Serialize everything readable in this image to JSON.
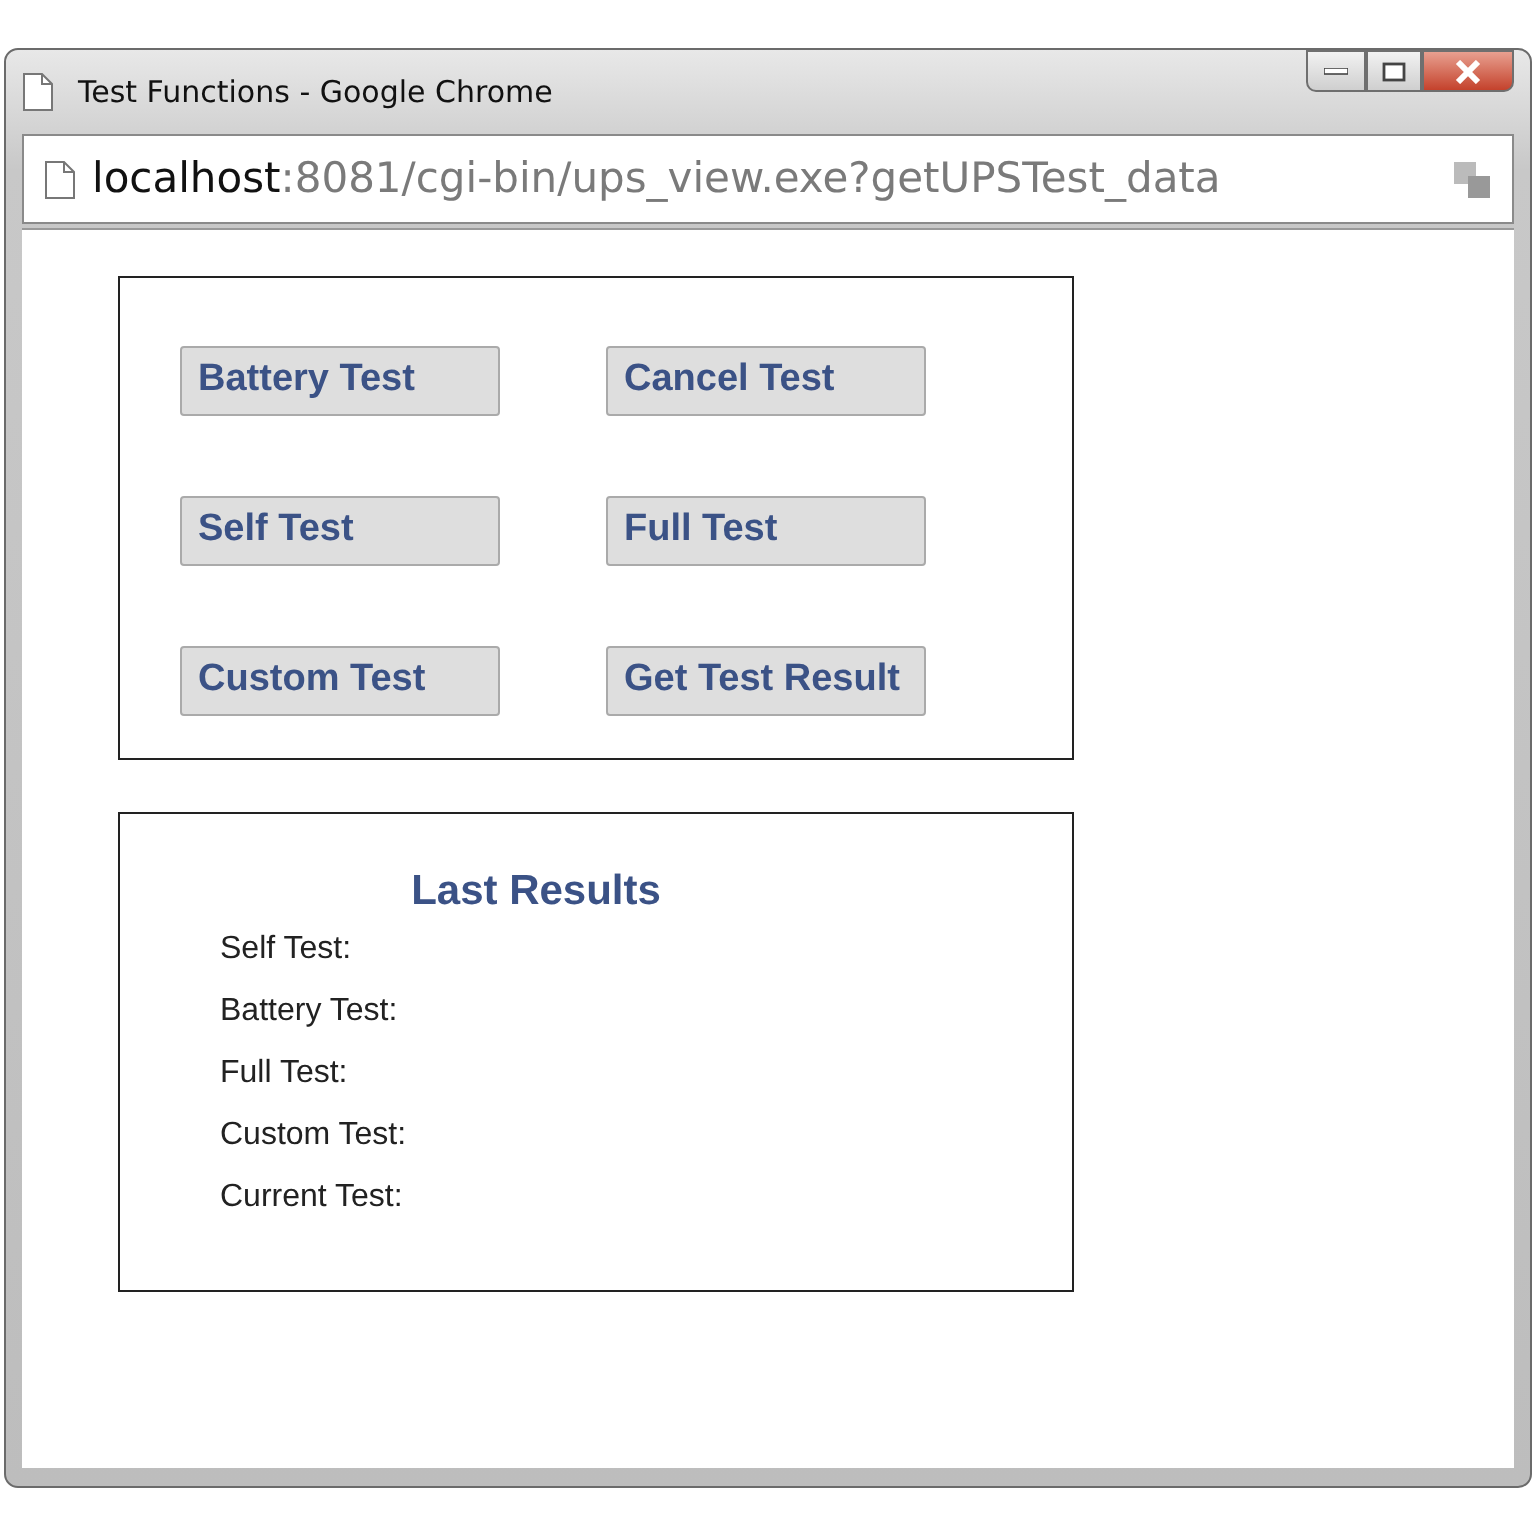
{
  "window": {
    "title": "Test Functions - Google Chrome"
  },
  "address_bar": {
    "host": "localhost",
    "path": ":8081/cgi-bin/ups_view.exe?getUPSTest_data"
  },
  "test_buttons": [
    {
      "label": "Battery Test"
    },
    {
      "label": "Cancel Test"
    },
    {
      "label": "Self Test"
    },
    {
      "label": "Full Test"
    },
    {
      "label": "Custom Test"
    },
    {
      "label": "Get Test Result"
    }
  ],
  "results": {
    "title": "Last Results",
    "items": [
      {
        "label": "Self Test:"
      },
      {
        "label": "Battery Test:"
      },
      {
        "label": "Full Test:"
      },
      {
        "label": "Custom Test:"
      },
      {
        "label": "Current Test:"
      }
    ]
  }
}
